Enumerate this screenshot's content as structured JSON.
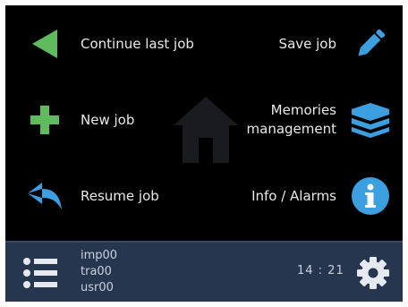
{
  "menu": {
    "continue_last_job": "Continue last job",
    "new_job": "New job",
    "resume_job": "Resume job",
    "save_job": "Save job",
    "memories_line1": "Memories",
    "memories_line2": "management",
    "info_alarms": "Info / Alarms"
  },
  "status": {
    "lines": [
      "imp00",
      "tra00",
      "usr00"
    ],
    "time": "14 : 21"
  },
  "icons": {
    "continue": "play-back-triangle-icon",
    "new": "plus-icon",
    "resume": "reply-arrow-icon",
    "save": "pencil-icon",
    "memories": "layers-icon",
    "info": "info-icon",
    "home": "home-icon",
    "menu": "list-icon",
    "settings": "gear-icon"
  },
  "colors": {
    "green": "#5fbb5d",
    "blue": "#3b9fe0",
    "footer": "#27364f"
  }
}
